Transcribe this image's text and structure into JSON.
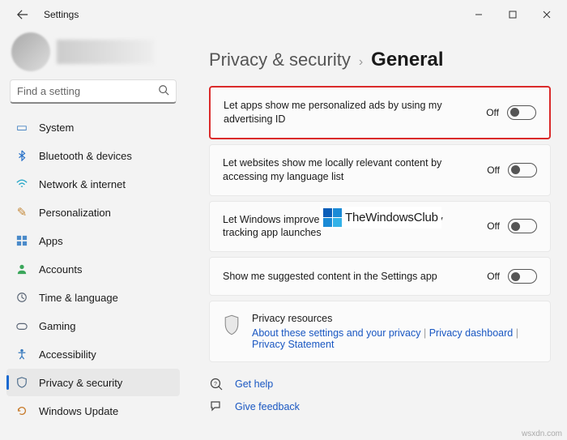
{
  "window": {
    "title": "Settings"
  },
  "search": {
    "placeholder": "Find a setting"
  },
  "sidebar": {
    "items": [
      {
        "label": "System"
      },
      {
        "label": "Bluetooth & devices"
      },
      {
        "label": "Network & internet"
      },
      {
        "label": "Personalization"
      },
      {
        "label": "Apps"
      },
      {
        "label": "Accounts"
      },
      {
        "label": "Time & language"
      },
      {
        "label": "Gaming"
      },
      {
        "label": "Accessibility"
      },
      {
        "label": "Privacy & security"
      },
      {
        "label": "Windows Update"
      }
    ]
  },
  "breadcrumb": {
    "parent": "Privacy & security",
    "current": "General"
  },
  "settings": [
    {
      "label": "Let apps show me personalized ads by using my advertising ID",
      "state": "Off",
      "on": false
    },
    {
      "label": "Let websites show me locally relevant content by accessing my language list",
      "state": "Off",
      "on": false
    },
    {
      "label": "Let Windows improve Start and search results by tracking app launches",
      "state": "Off",
      "on": false
    },
    {
      "label": "Show me suggested content in the Settings app",
      "state": "Off",
      "on": false
    }
  ],
  "resources": {
    "title": "Privacy resources",
    "links": [
      "About these settings and your privacy",
      "Privacy dashboard",
      "Privacy Statement"
    ]
  },
  "footer": {
    "help": "Get help",
    "feedback": "Give feedback"
  },
  "overlay": {
    "brand": "TheWindowsClub"
  },
  "credit": "wsxdn.com"
}
